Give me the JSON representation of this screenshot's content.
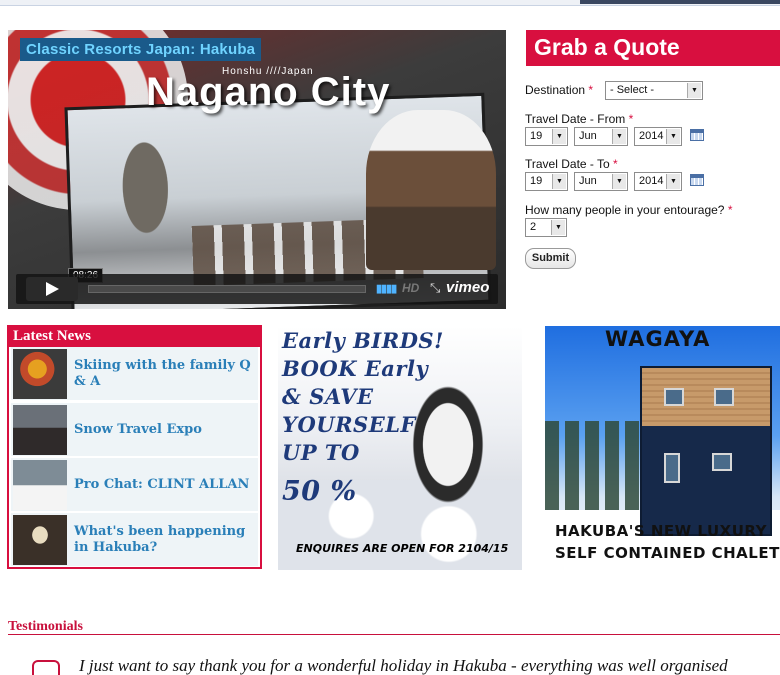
{
  "video": {
    "title": "Classic Resorts Japan: Hakuba",
    "subtitle": "Honshu ////Japan",
    "city": "Nagano City",
    "time": "08:26",
    "progress": 0.0,
    "hd_label": "HD",
    "brand": "vimeo"
  },
  "quote": {
    "header": "Grab a Quote",
    "destination_label": "Destination",
    "destination_value": "- Select -",
    "from_label": "Travel Date - From",
    "from_day": "19",
    "from_month": "Jun",
    "from_year": "2014",
    "to_label": "Travel Date - To",
    "to_day": "19",
    "to_month": "Jun",
    "to_year": "2014",
    "people_label": "How many people in your entourage?",
    "people_value": "2",
    "required_mark": "*",
    "submit_label": "Submit"
  },
  "news": {
    "heading": "Latest News",
    "items": [
      {
        "title": "Skiing with the family Q & A"
      },
      {
        "title": "Snow Travel Expo"
      },
      {
        "title": "Pro Chat: CLINT ALLAN"
      },
      {
        "title": "What's been happening in Hakuba?"
      }
    ]
  },
  "banner_birds": {
    "line1": "Early BIRDS!",
    "line2": "BOOK Early",
    "line3": "& SAVE",
    "line4": "YOURSELF",
    "line5": "UP TO",
    "line6": "50 %",
    "footer": "ENQUIRES ARE OPEN FOR 2104/15"
  },
  "banner_wagaya": {
    "title": "WAGAYA",
    "line1": "HAKUBA'S NEW LUXURY",
    "line2": "SELF CONTAINED CHALET"
  },
  "testimonials": {
    "heading": "Testimonials",
    "text": "I just want to say thank you for a wonderful holiday in Hakuba - everything was well organised"
  }
}
